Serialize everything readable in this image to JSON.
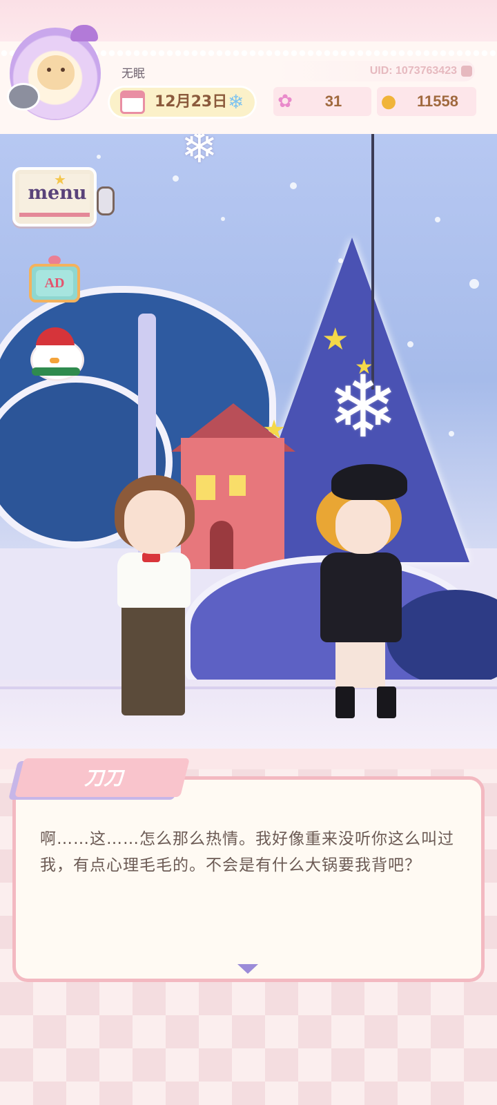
{
  "header": {
    "username": "无眠",
    "uid": "UID: 1073763423",
    "date": "12月23日",
    "flowers": "31",
    "coins": "11558"
  },
  "icons": {
    "avatar": "hamster-avatar-icon",
    "calendar": "calendar-icon",
    "weather": "snowflake-icon",
    "flower": "rainbow-flower-icon",
    "coin": "gold-coin-icon"
  },
  "side_buttons": {
    "menu": "menu",
    "ad": "AD"
  },
  "dialog": {
    "speaker": "刀刀",
    "text": "啊……这……怎么那么热情。我好像重来没听你这么叫过我，有点心理毛毛的。不会是有什么大锅要我背吧？"
  },
  "colors": {
    "accent_pink": "#f3b9c1",
    "coin_text": "#a0693e",
    "menu_text": "#59427a"
  }
}
